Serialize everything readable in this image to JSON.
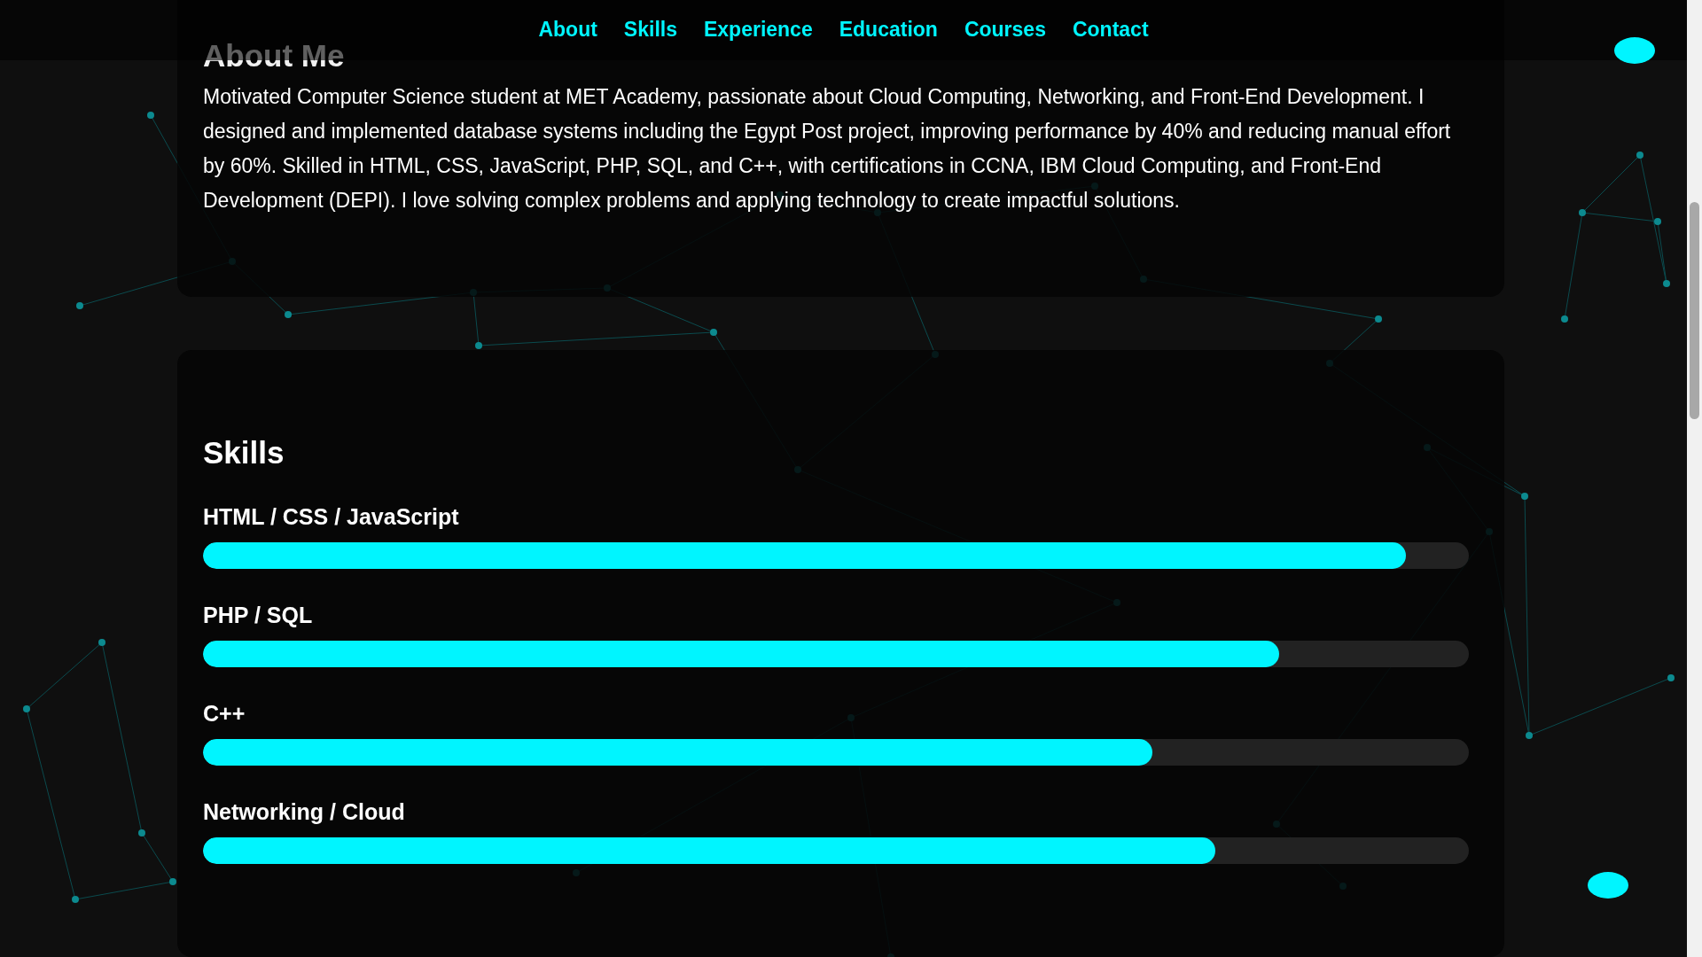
{
  "nav": {
    "links": [
      {
        "label": "About"
      },
      {
        "label": "Skills"
      },
      {
        "label": "Experience"
      },
      {
        "label": "Education"
      },
      {
        "label": "Courses"
      },
      {
        "label": "Contact"
      }
    ]
  },
  "about": {
    "heading": "About Me",
    "text": "Motivated Computer Science student at MET Academy, passionate about Cloud Computing, Networking, and Front-End Development. I designed and implemented database systems including the Egypt Post project, improving performance by 40% and reducing manual effort by 60%. Skilled in HTML, CSS, JavaScript, PHP, SQL, and C++, with certifications in CCNA, IBM Cloud Computing, and Front-End Development (DEPI). I love solving complex problems and applying technology to create impactful solutions."
  },
  "skills": {
    "heading": "Skills",
    "items": [
      {
        "name": "HTML / CSS / JavaScript",
        "level": 0.95
      },
      {
        "name": "PHP / SQL",
        "level": 0.85
      },
      {
        "name": "C++",
        "level": 0.75
      },
      {
        "name": "Networking / Cloud",
        "level": 0.8
      }
    ]
  }
}
